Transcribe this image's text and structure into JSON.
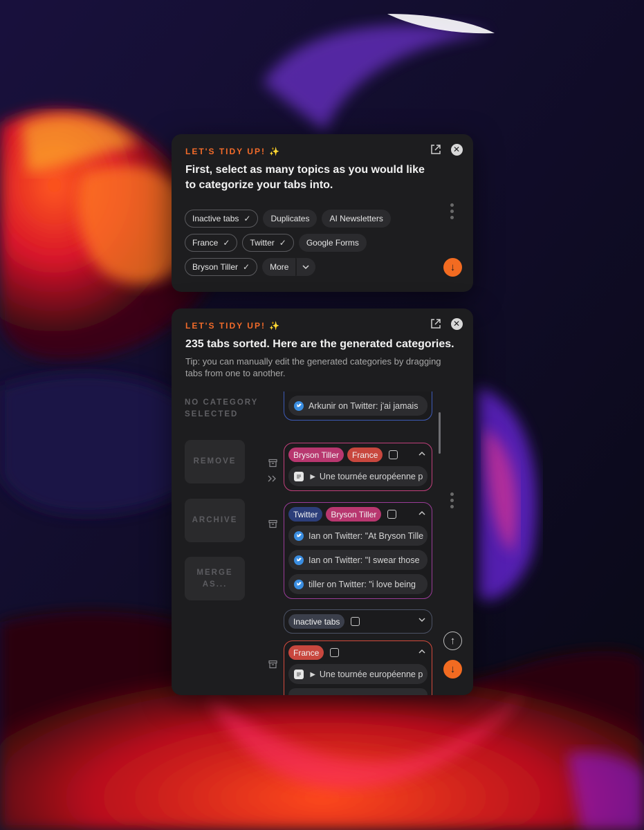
{
  "colors": {
    "accent": "#f26b21",
    "panel_bg": "#1d1d1f",
    "tag_pink": "#b8376f",
    "tag_red": "#c8473e",
    "tag_blue": "#2c3e7a",
    "tag_gray": "#3b3f4b"
  },
  "panel1": {
    "kicker": "LET'S TIDY UP! ✨",
    "title": "First, select as many topics as you would like to categorize your tabs into.",
    "chips": [
      [
        {
          "label": "Inactive tabs",
          "selected": true
        },
        {
          "label": "Duplicates",
          "selected": false
        },
        {
          "label": "AI Newsletters",
          "selected": false
        }
      ],
      [
        {
          "label": "France",
          "selected": true
        },
        {
          "label": "Twitter",
          "selected": true
        },
        {
          "label": "Google Forms",
          "selected": false
        }
      ],
      [
        {
          "label": "Bryson Tiller",
          "selected": true
        },
        {
          "label": "More",
          "selected": false
        }
      ]
    ],
    "icons": {
      "external": "external-link-icon",
      "close": "close-icon",
      "menu": "kebab-menu-icon",
      "fab": "arrow-down-icon"
    }
  },
  "panel2": {
    "kicker": "LET'S TIDY UP! ✨",
    "title": "235 tabs sorted. Here are the generated categories.",
    "tip": "Tip: you can manually edit the generated categories by dragging tabs from one to another.",
    "no_category": "NO CATEGORY SELECTED",
    "buttons": {
      "remove": "REMOVE",
      "archive": "ARCHIVE",
      "merge": "MERGE AS..."
    },
    "categories": [
      {
        "tags": [],
        "tabs": [
          {
            "icon": "twitter",
            "title": "Arkunir on Twitter: j'ai jamais"
          }
        ]
      },
      {
        "tags": [
          "Bryson Tiller",
          "France"
        ],
        "tabs": [
          {
            "icon": "doc",
            "title": "► Une tournée européenne p"
          }
        ]
      },
      {
        "tags": [
          "Twitter",
          "Bryson Tiller"
        ],
        "tabs": [
          {
            "icon": "twitter",
            "title": "Ian on Twitter: \"At Bryson Tille"
          },
          {
            "icon": "twitter",
            "title": "Ian on Twitter: \"I swear those"
          },
          {
            "icon": "twitter",
            "title": "tiller on Twitter: \"i love being"
          }
        ]
      },
      {
        "tags": [
          "Inactive tabs"
        ],
        "tabs": []
      },
      {
        "tags": [
          "France"
        ],
        "tabs": [
          {
            "icon": "doc",
            "title": "► Une tournée européenne p"
          }
        ]
      }
    ]
  }
}
